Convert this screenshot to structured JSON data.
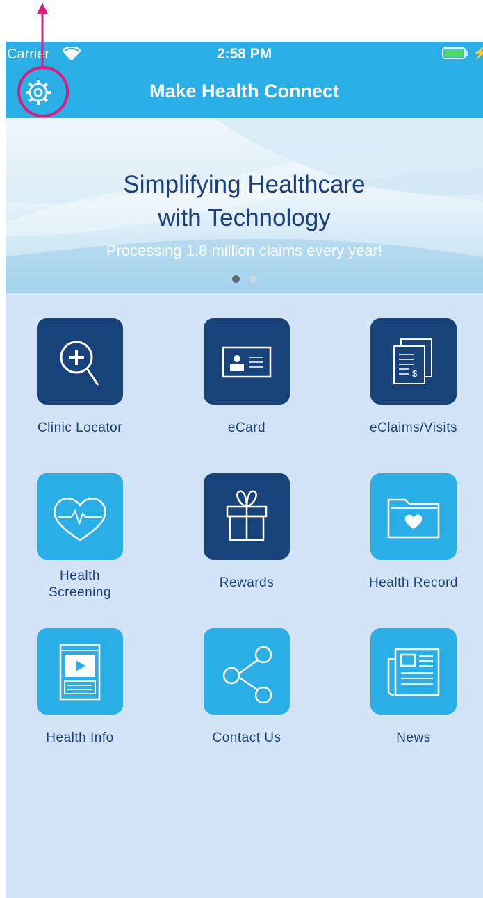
{
  "status_bar": {
    "carrier": "Carrier",
    "time": "2:58 PM",
    "battery_level": 1.0,
    "battery_color": "#4cd964"
  },
  "nav_bar": {
    "title": "Make Health Connect",
    "settings_icon": "gear-icon"
  },
  "banner": {
    "headline_line1": "Simplifying Healthcare",
    "headline_line2": "with Technology",
    "subtext": "Processing 1.8 million claims every year!",
    "page_count": 2,
    "active_page": 1
  },
  "menu": [
    {
      "label": "Clinic Locator",
      "icon": "magnifier-plus-icon",
      "style": "dark"
    },
    {
      "label": "eCard",
      "icon": "id-card-icon",
      "style": "dark"
    },
    {
      "label": "eClaims/Visits",
      "icon": "claim-documents-icon",
      "style": "dark"
    },
    {
      "label": "Health\nScreening",
      "icon": "heartbeat-icon",
      "style": "light"
    },
    {
      "label": "Rewards",
      "icon": "gift-icon",
      "style": "dark"
    },
    {
      "label": "Health Record",
      "icon": "heart-folder-icon",
      "style": "light"
    },
    {
      "label": "Health Info",
      "icon": "video-article-icon",
      "style": "light"
    },
    {
      "label": "Contact Us",
      "icon": "share-icon",
      "style": "light"
    },
    {
      "label": "News",
      "icon": "newspaper-icon",
      "style": "light"
    }
  ],
  "colors": {
    "header": "#2aaee6",
    "background": "#d3e4f7",
    "tile_dark": "#18427a",
    "tile_light": "#2aaee6",
    "text": "#1b3f7c",
    "annotation": "#e0197a"
  }
}
